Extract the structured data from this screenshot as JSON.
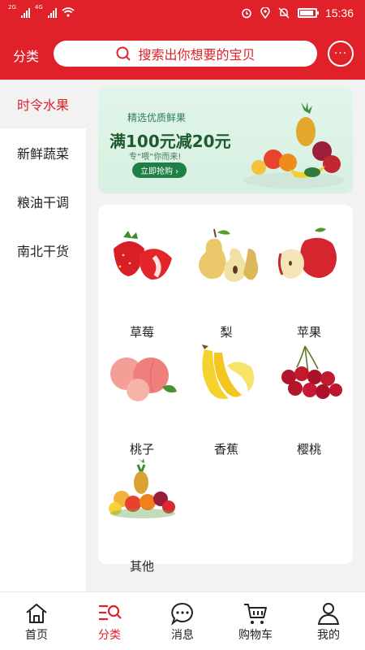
{
  "status": {
    "time": "15:36",
    "net1": "2G",
    "net2": "4G"
  },
  "header": {
    "title": "分类",
    "search_placeholder": "搜索出你想要的宝贝"
  },
  "sidebar": {
    "items": [
      {
        "label": "时令水果",
        "active": true
      },
      {
        "label": "新鲜蔬菜",
        "active": false
      },
      {
        "label": "粮油干调",
        "active": false
      },
      {
        "label": "南北干货",
        "active": false
      }
    ]
  },
  "banner": {
    "line1": "精选优质鲜果",
    "line2": "满100元减20元",
    "line3": "专“喂”你而来!",
    "button": "立即抢购 ›"
  },
  "products": [
    {
      "name": "草莓",
      "icon": "strawberry"
    },
    {
      "name": "梨",
      "icon": "pear"
    },
    {
      "name": "苹果",
      "icon": "apple"
    },
    {
      "name": "桃子",
      "icon": "peach"
    },
    {
      "name": "香蕉",
      "icon": "banana"
    },
    {
      "name": "樱桃",
      "icon": "cherry"
    },
    {
      "name": "其他",
      "icon": "fruit-basket"
    }
  ],
  "bottom_nav": [
    {
      "label": "首页",
      "icon": "home-icon",
      "active": false
    },
    {
      "label": "分类",
      "icon": "category-icon",
      "active": true
    },
    {
      "label": "消息",
      "icon": "message-icon",
      "active": false
    },
    {
      "label": "购物车",
      "icon": "cart-icon",
      "active": false
    },
    {
      "label": "我的",
      "icon": "profile-icon",
      "active": false
    }
  ],
  "colors": {
    "accent": "#e0212a",
    "background": "#f2f2f2"
  }
}
